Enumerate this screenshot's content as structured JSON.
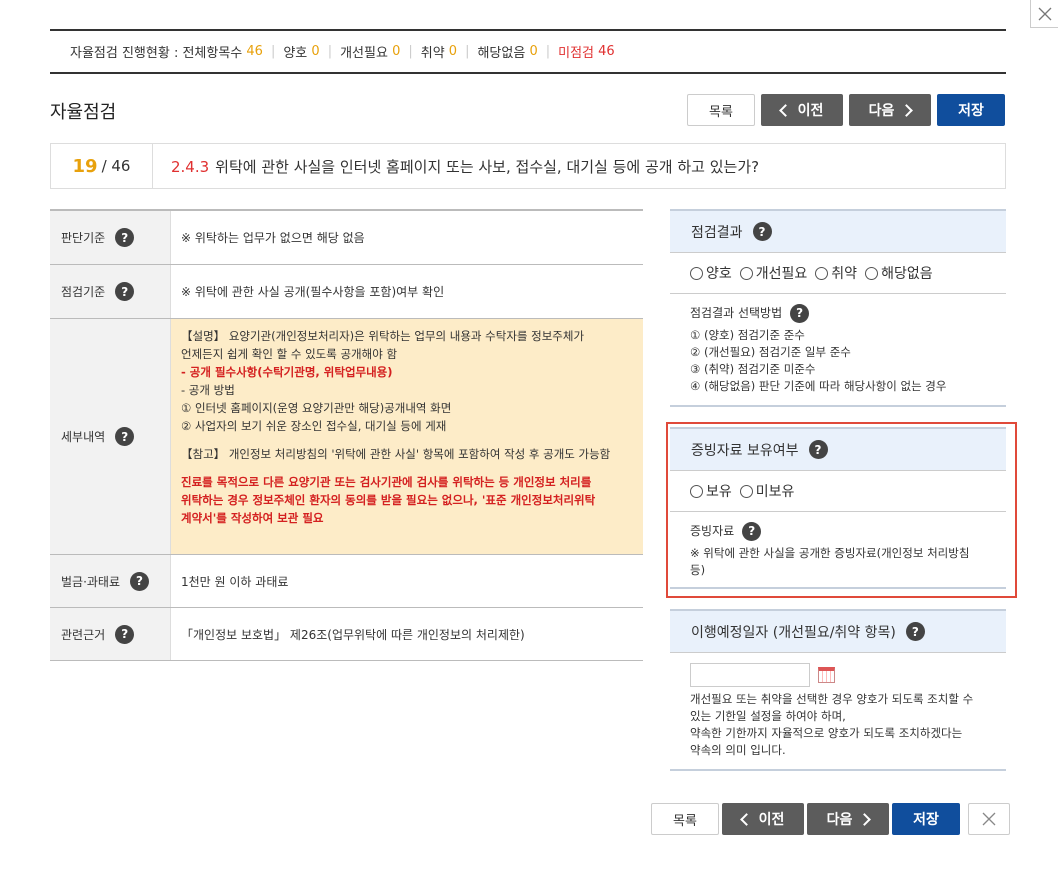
{
  "status": {
    "label": "자율점검 진행현황 : 전체항목수",
    "total": "46",
    "good_label": "양호",
    "good": "0",
    "improve_label": "개선필요",
    "improve": "0",
    "weak_label": "취약",
    "weak": "0",
    "na_label": "해당없음",
    "na": "0",
    "unchecked_label": "미점검",
    "unchecked": "46"
  },
  "page_title": "자율점검",
  "buttons": {
    "list": "목록",
    "prev": "이전",
    "next": "다음",
    "save": "저장"
  },
  "question": {
    "current": "19",
    "total": "/ 46",
    "code": "2.4.3",
    "text": "위탁에 관한 사실을 인터넷 홈페이지 또는 사보, 접수실, 대기실 등에 공개 하고 있는가?"
  },
  "rows": {
    "criterion_label": "판단기준",
    "criterion": "※ 위탁하는 업무가 없으면 해당 없음",
    "check_label": "점검기준",
    "check": "※ 위탁에 관한 사실 공개(필수사항을 포함)여부 확인",
    "detail_label": "세부내역",
    "detail": {
      "line1": "【설명】 요양기관(개인정보처리자)은 위탁하는 업무의 내용과 수탁자를 정보주체가",
      "line2": "언제든지 쉽게 확인 할 수 있도록 공개해야 함",
      "line3": "- 공개 필수사항(수탁기관명, 위탁업무내용)",
      "line4": "- 공개 방법",
      "line5": "① 인터넷 홈페이지(운영 요양기관만 해당)공개내역 화면",
      "line6": "② 사업자의 보기 쉬운 장소인 접수실, 대기실 등에 게재",
      "line7": "【참고】 개인정보 처리방침의 '위탁에 관한 사실' 항목에 포함하여 작성 후 공개도 가능함",
      "red1": "진료를 목적으로 다른 요양기관 또는 검사기관에 검사를 위탁하는 등 개인정보 처리를",
      "red2": "위탁하는 경우 정보주체인 환자의 동의를 받을 필요는 없으나, '표준 개인정보처리위탁",
      "red3": "계약서'를 작성하여 보관 필요"
    },
    "penalty_label": "벌금·과태료",
    "penalty": "1천만 원 이하 과태료",
    "basis_label": "관련근거",
    "basis": "「개인정보 보호법」 제26조(업무위탁에 따른 개인정보의 처리제한)"
  },
  "result": {
    "title": "점검결과",
    "options": [
      "양호",
      "개선필요",
      "취약",
      "해당없음"
    ],
    "method_title": "점검결과 선택방법",
    "methods": [
      "① (양호) 점검기준 준수",
      "② (개선필요) 점검기준 일부 준수",
      "③ (취약) 점검기준 미준수",
      "④ (해당없음) 판단 기준에 따라 해당사항이 없는 경우"
    ]
  },
  "evidence": {
    "title": "증빙자료 보유여부",
    "options": [
      "보유",
      "미보유"
    ],
    "sub_title": "증빙자료",
    "desc": "※ 위탁에 관한 사실을 공개한 증빙자료(개인정보 처리방침 등)"
  },
  "due": {
    "title": "이행예정일자 (개선필요/취약 항목)",
    "date_value": "",
    "note1": "개선필요 또는 취약을 선택한 경우 양호가 되도록 조치할 수",
    "note2": "있는 기한일 설정을 하여야 하며,",
    "note3": "약속한 기한까지 자율적으로 양호가 되도록 조치하겠다는",
    "note4": "약속의 의미 입니다."
  },
  "help_glyph": "?"
}
